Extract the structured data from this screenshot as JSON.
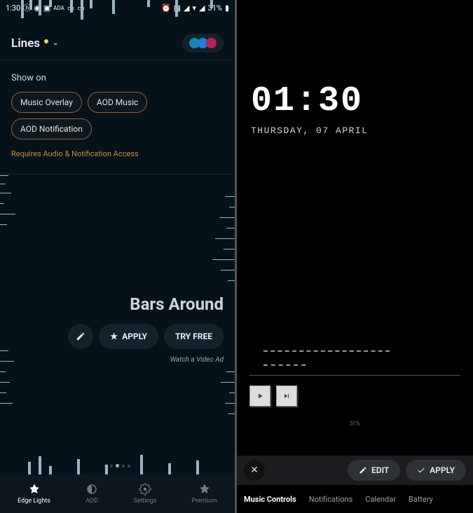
{
  "left": {
    "status": {
      "time": "1:30",
      "battery": "31%"
    },
    "title": "Lines",
    "show_on": {
      "label": "Show on",
      "chips": [
        "Music Overlay",
        "AOD Music",
        "AOD Notification"
      ],
      "requires": "Requires Audio & Notification Access"
    },
    "effect": {
      "name": "Bars Around",
      "apply": "APPLY",
      "try_free": "TRY FREE",
      "ad": "Watch a Video Ad"
    },
    "nav": {
      "items": [
        "Edge Lights",
        "AOD",
        "Settings",
        "Premium"
      ]
    }
  },
  "right": {
    "clock": {
      "time": "01:30",
      "date": "THURSDAY, 07 APRIL"
    },
    "battery_small": "31%",
    "actions": {
      "edit": "EDIT",
      "apply": "APPLY"
    },
    "tabs": [
      "Music Controls",
      "Notifications",
      "Calendar",
      "Battery"
    ]
  }
}
